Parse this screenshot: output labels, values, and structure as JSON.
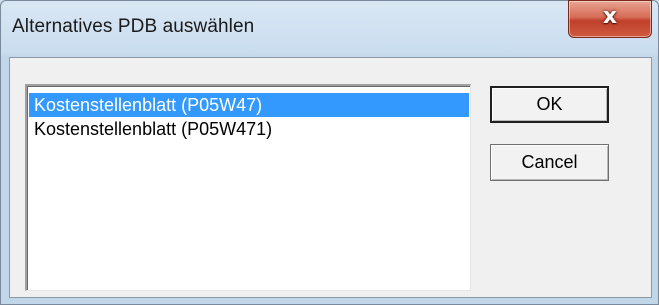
{
  "window": {
    "title": "Alternatives PDB auswählen",
    "close_glyph": "x"
  },
  "list": {
    "items": [
      {
        "label": "Kostenstellenblatt (P05W47)",
        "selected": true
      },
      {
        "label": "Kostenstellenblatt (P05W471)",
        "selected": false
      }
    ]
  },
  "buttons": {
    "ok_label": "OK",
    "cancel_label": "Cancel"
  },
  "colors": {
    "selection": "#3399ff",
    "close_button": "#c0402a"
  }
}
